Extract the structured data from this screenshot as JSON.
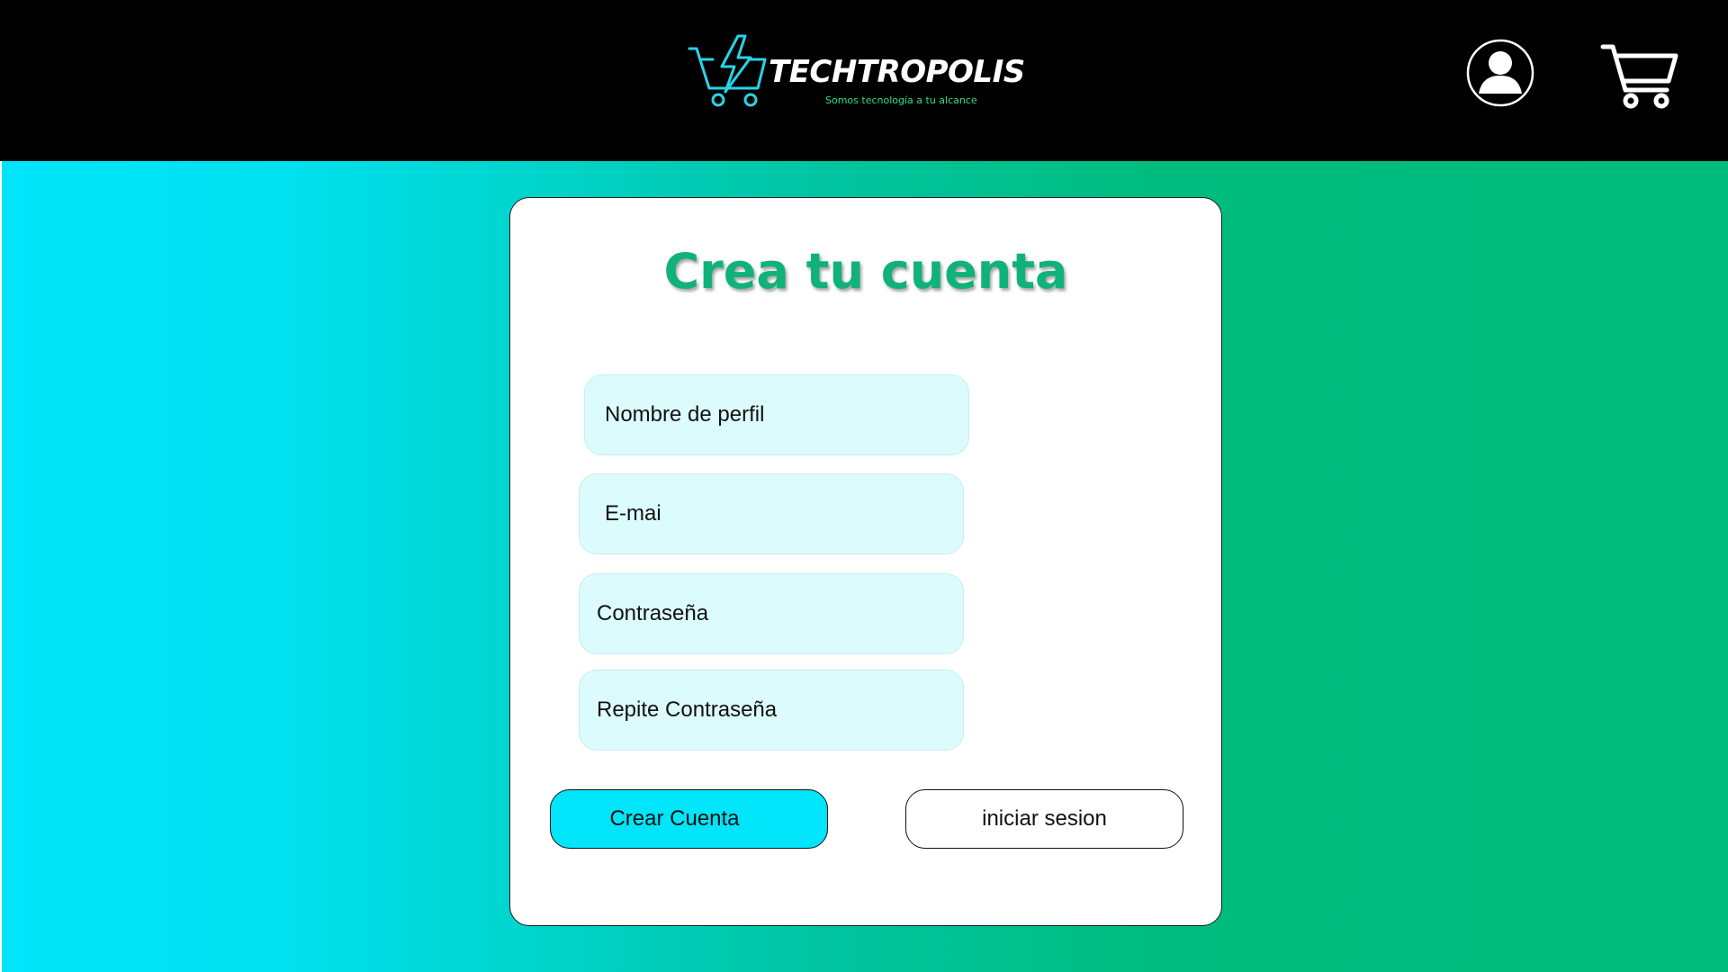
{
  "header": {
    "brand_name": "TECHTROPOLIS",
    "tagline": "Somos tecnología a tu alcance",
    "logo_icon": "cart-lightning-logo",
    "user_icon": "user-account-icon",
    "cart_icon": "shopping-cart-icon"
  },
  "form": {
    "title": "Crea tu cuenta",
    "fields": [
      {
        "label": "Nombre de perfil"
      },
      {
        "label": "E-mai"
      },
      {
        "label": "Contraseña"
      },
      {
        "label": "Repite Contraseña"
      }
    ],
    "create_account_label": "Crear Cuenta",
    "login_label": "iniciar sesion"
  },
  "colors": {
    "header_bg": "#000000",
    "accent_cyan": "#00e5fa",
    "accent_green": "#00bc7c",
    "title_green": "#11b27a",
    "field_bg": "#dcfbfd",
    "tagline_green": "#27e08a"
  }
}
